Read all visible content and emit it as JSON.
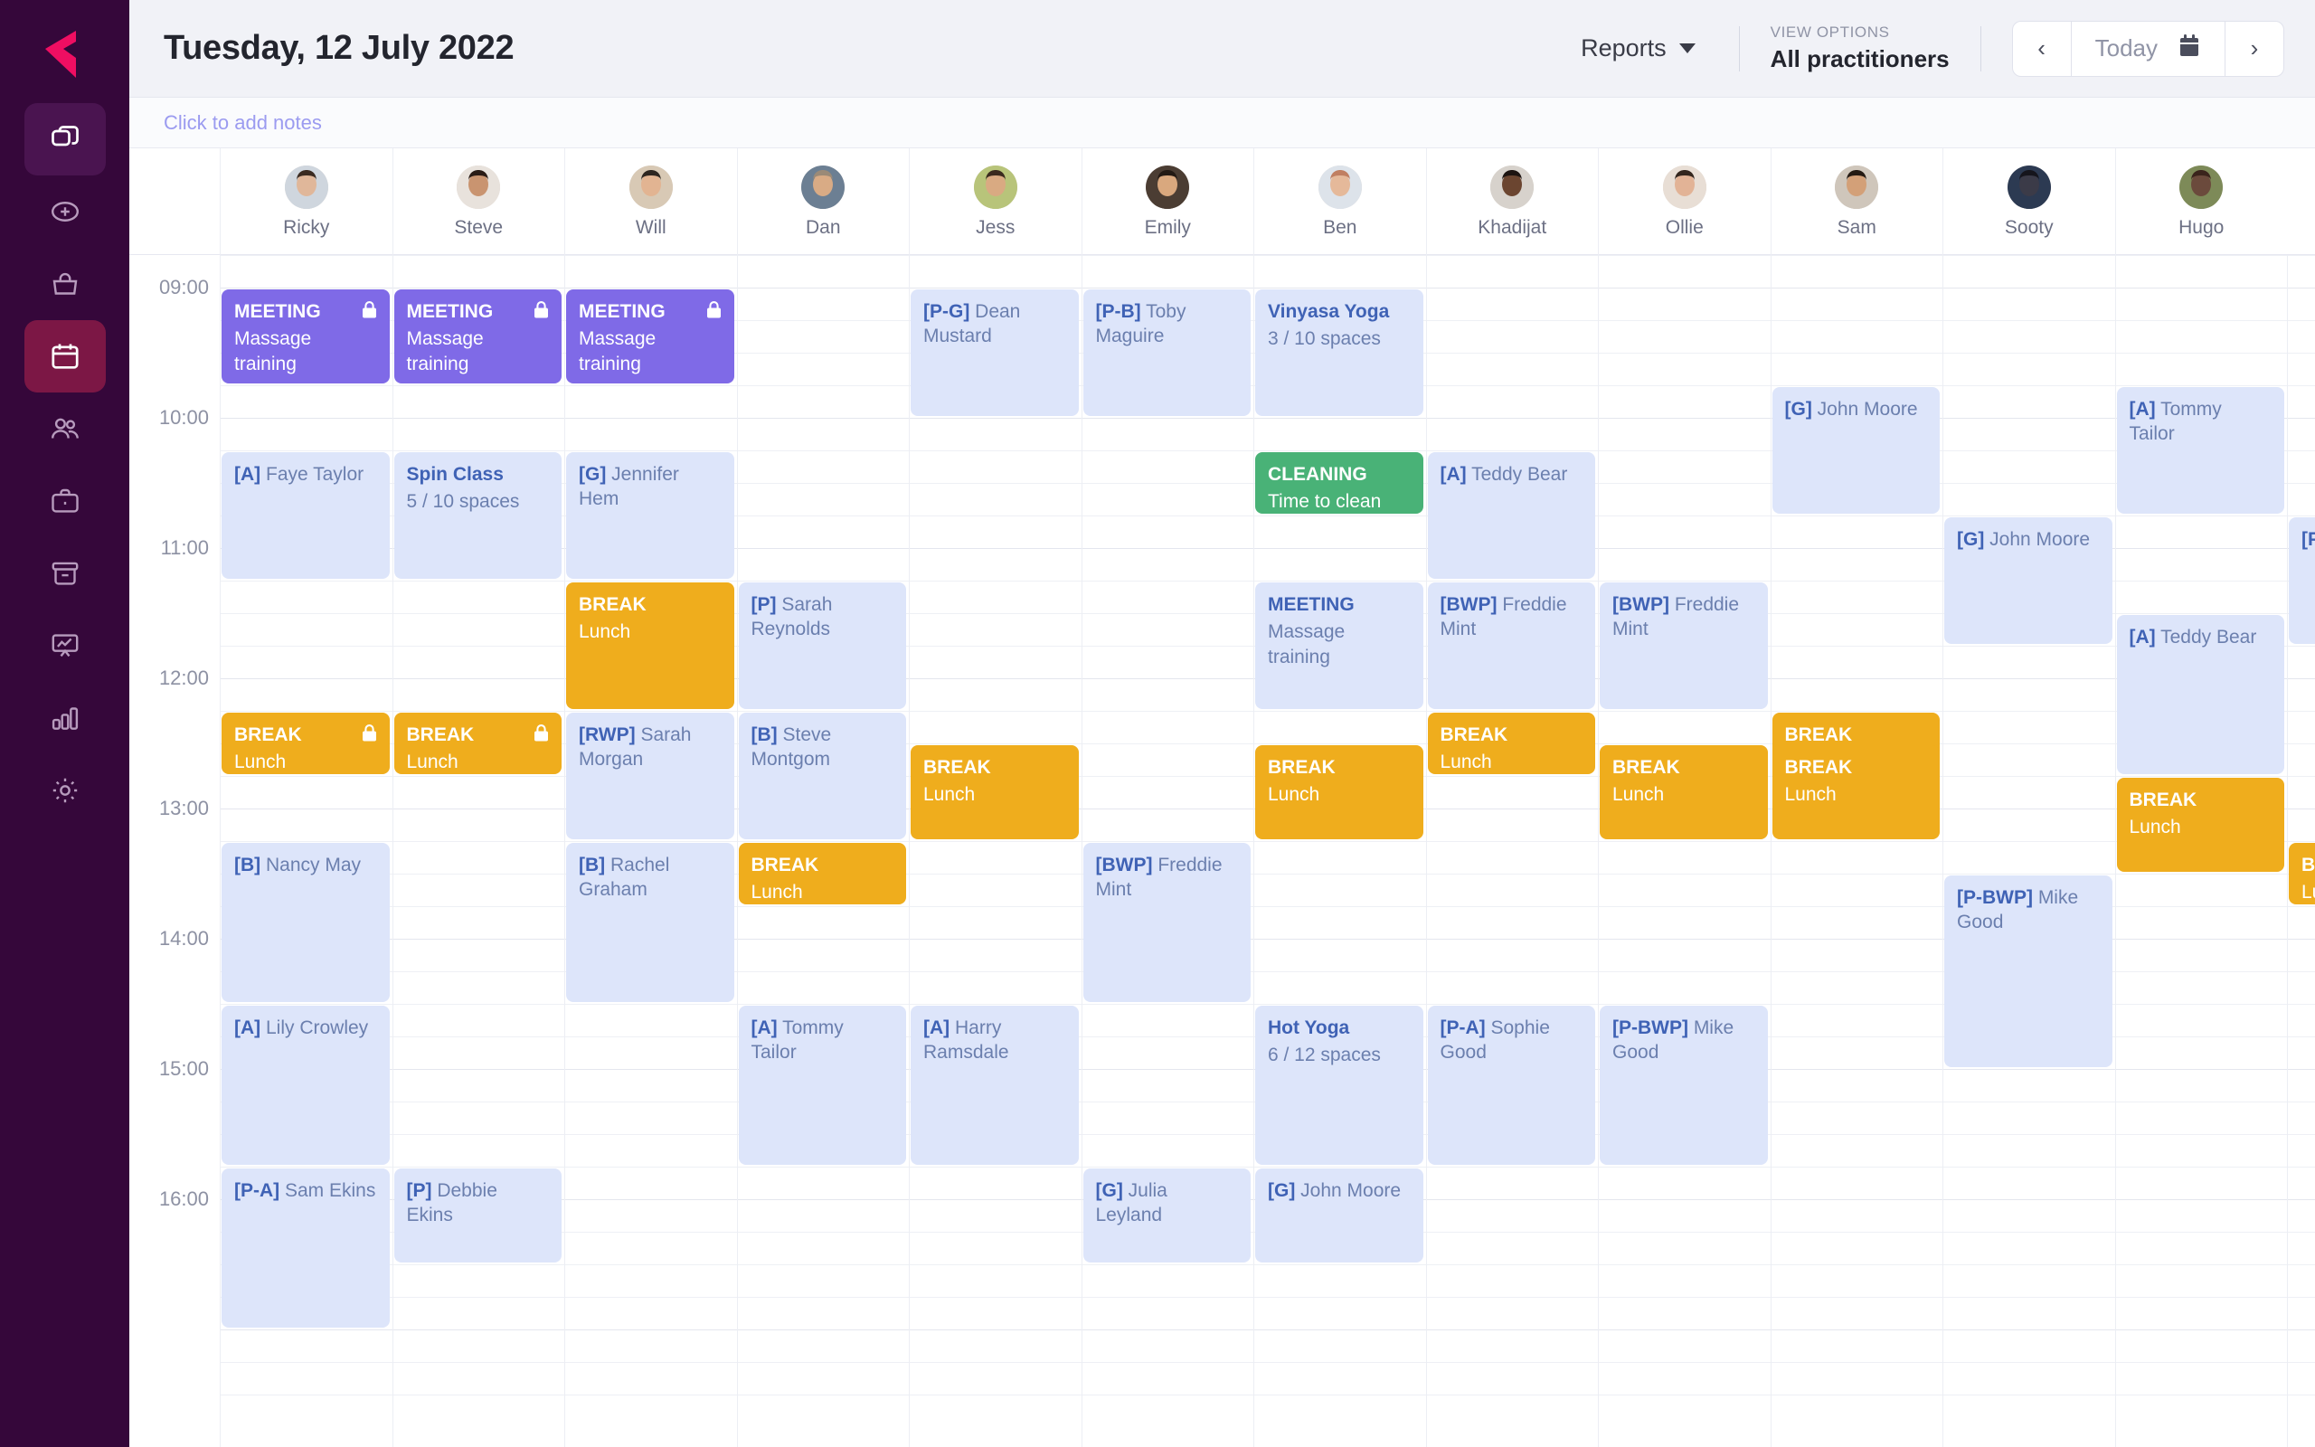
{
  "app": {
    "logo_name": "logo-mark",
    "accent_color": "#ef0e62",
    "nav_bg": "#35073a"
  },
  "nav": {
    "items": [
      {
        "icon": "copy-stack-icon",
        "name": "sidebar-item-dashboard",
        "state": "selected-dark"
      },
      {
        "icon": "plus-circle-icon",
        "name": "sidebar-item-add",
        "state": "normal"
      },
      {
        "icon": "bag-icon",
        "name": "sidebar-item-sales",
        "state": "normal"
      },
      {
        "icon": "calendar-icon",
        "name": "sidebar-item-calendar",
        "state": "selected-accent"
      },
      {
        "icon": "people-icon",
        "name": "sidebar-item-clients",
        "state": "normal"
      },
      {
        "icon": "briefcase-icon",
        "name": "sidebar-item-business",
        "state": "normal"
      },
      {
        "icon": "archive-icon",
        "name": "sidebar-item-stock",
        "state": "normal"
      },
      {
        "icon": "presentation-chart-icon",
        "name": "sidebar-item-marketing",
        "state": "normal"
      },
      {
        "icon": "bar-chart-icon",
        "name": "sidebar-item-reports",
        "state": "normal"
      },
      {
        "icon": "gear-icon",
        "name": "sidebar-item-settings",
        "state": "normal"
      }
    ]
  },
  "header": {
    "title": "Tuesday, 12 July 2022",
    "reports_label": "Reports",
    "view_options_label": "VIEW OPTIONS",
    "view_options_value": "All practitioners",
    "prev_label": "‹",
    "next_label": "›",
    "today_label": "Today"
  },
  "notes": {
    "placeholder": "Click to add notes"
  },
  "calendar": {
    "practitioners": [
      {
        "name": "Ricky",
        "skin": "#e0b79a",
        "hair": "#3a2b22",
        "shirt": "#cfd6de"
      },
      {
        "name": "Steve",
        "skin": "#c99470",
        "hair": "#2a1c16",
        "shirt": "#e8e2dc"
      },
      {
        "name": "Will",
        "skin": "#e2b492",
        "hair": "#2e2620",
        "shirt": "#d8c9b5"
      },
      {
        "name": "Dan",
        "skin": "#d9ab85",
        "hair": "#9b8a77",
        "shirt": "#6c7f93"
      },
      {
        "name": "Jess",
        "skin": "#d9aa82",
        "hair": "#3a2a1e",
        "shirt": "#b8c47a"
      },
      {
        "name": "Emily",
        "skin": "#d9a87e",
        "hair": "#231a14",
        "shirt": "#4b3d33"
      },
      {
        "name": "Ben",
        "skin": "#e5b99a",
        "hair": "#c07f62",
        "shirt": "#dde3ea"
      },
      {
        "name": "Khadijat",
        "skin": "#6b4530",
        "hair": "#1d1411",
        "shirt": "#d7d2cc"
      },
      {
        "name": "Ollie",
        "skin": "#e2b396",
        "hair": "#33261e",
        "shirt": "#e8ded5"
      },
      {
        "name": "Sam",
        "skin": "#d3a078",
        "hair": "#241a13",
        "shirt": "#cfc6bb"
      },
      {
        "name": "Sooty",
        "skin": "#3b3b48",
        "hair": "#15151c",
        "shirt": "#2c3a52"
      },
      {
        "name": "Hugo",
        "skin": "#6b4a3c",
        "hair": "#3a241c",
        "shirt": "#7d8a58"
      }
    ],
    "time_labels": [
      "09:00",
      "10:00",
      "11:00",
      "12:00",
      "13:00",
      "14:00",
      "15:00",
      "16:00"
    ],
    "slot_minutes": 15,
    "start_time": "08:45",
    "events": [
      {
        "col": 0,
        "start": "09:00",
        "end": "09:45",
        "type": "purple",
        "title": "MEETING",
        "subtitle": "Massage training",
        "locked": true
      },
      {
        "col": 1,
        "start": "09:00",
        "end": "09:45",
        "type": "purple",
        "title": "MEETING",
        "subtitle": "Massage training",
        "locked": true
      },
      {
        "col": 2,
        "start": "09:00",
        "end": "09:45",
        "type": "purple",
        "title": "MEETING",
        "subtitle": "Massage training",
        "locked": true
      },
      {
        "col": 4,
        "start": "09:00",
        "end": "10:00",
        "type": "blue",
        "code": "[P-G]",
        "client": "Dean Mustard"
      },
      {
        "col": 5,
        "start": "09:00",
        "end": "10:00",
        "type": "blue",
        "code": "[P-B]",
        "client": "Toby Maguire"
      },
      {
        "col": 6,
        "start": "09:00",
        "end": "10:00",
        "type": "blue",
        "title": "Vinyasa Yoga",
        "subtitle": "3 / 10 spaces"
      },
      {
        "col": 9,
        "start": "09:45",
        "end": "10:45",
        "type": "blue",
        "code": "[G]",
        "client": "John Moore"
      },
      {
        "col": 11,
        "start": "09:45",
        "end": "10:45",
        "type": "blue",
        "code": "[A]",
        "client": "Tommy Tailor"
      },
      {
        "col": 0,
        "start": "10:15",
        "end": "11:15",
        "type": "blue",
        "code": "[A]",
        "client": "Faye Taylor"
      },
      {
        "col": 1,
        "start": "10:15",
        "end": "11:15",
        "type": "blue",
        "title": "Spin Class",
        "subtitle": "5 / 10 spaces"
      },
      {
        "col": 2,
        "start": "10:15",
        "end": "11:15",
        "type": "blue",
        "code": "[G]",
        "client": "Jennifer Hem"
      },
      {
        "col": 6,
        "start": "10:15",
        "end": "10:45",
        "type": "green",
        "title": "CLEANING",
        "subtitle": "Time to clean"
      },
      {
        "col": 7,
        "start": "10:15",
        "end": "11:15",
        "type": "blue",
        "code": "[A]",
        "client": "Teddy Bear"
      },
      {
        "col": 10,
        "start": "10:45",
        "end": "11:45",
        "type": "blue",
        "code": "[G]",
        "client": "John Moore"
      },
      {
        "col": 2,
        "start": "11:15",
        "end": "12:15",
        "type": "orange",
        "title": "BREAK",
        "subtitle": "Lunch"
      },
      {
        "col": 3,
        "start": "11:15",
        "end": "12:15",
        "type": "blue",
        "code": "[P]",
        "client": "Sarah Reynolds"
      },
      {
        "col": 6,
        "start": "11:15",
        "end": "12:15",
        "type": "blue",
        "title": "MEETING",
        "subtitle": "Massage training"
      },
      {
        "col": 7,
        "start": "11:15",
        "end": "12:15",
        "type": "blue",
        "code": "[BWP]",
        "client": "Freddie Mint"
      },
      {
        "col": 8,
        "start": "11:15",
        "end": "12:15",
        "type": "blue",
        "code": "[BWP]",
        "client": "Freddie Mint"
      },
      {
        "col": 11,
        "start": "11:30",
        "end": "12:45",
        "type": "blue",
        "code": "[A]",
        "client": "Teddy Bear"
      },
      {
        "col": 0,
        "start": "12:15",
        "end": "12:45",
        "type": "orange",
        "title": "BREAK",
        "subtitle": "Lunch",
        "locked": true
      },
      {
        "col": 1,
        "start": "12:15",
        "end": "12:45",
        "type": "orange",
        "title": "BREAK",
        "subtitle": "Lunch",
        "locked": true
      },
      {
        "col": 2,
        "start": "12:15",
        "end": "13:15",
        "type": "blue",
        "code": "[RWP]",
        "client": "Sarah Morgan"
      },
      {
        "col": 3,
        "start": "12:15",
        "end": "13:15",
        "type": "blue",
        "code": "[B]",
        "client": "Steve Montgom"
      },
      {
        "col": 7,
        "start": "12:15",
        "end": "12:45",
        "type": "orange",
        "title": "BREAK",
        "subtitle": "Lunch"
      },
      {
        "col": 9,
        "start": "12:15",
        "end": "12:45",
        "type": "orange",
        "title": "BREAK",
        "subtitle": "Lunch"
      },
      {
        "col": 4,
        "start": "12:30",
        "end": "13:15",
        "type": "orange",
        "title": "BREAK",
        "subtitle": "Lunch"
      },
      {
        "col": 6,
        "start": "12:30",
        "end": "13:15",
        "type": "orange",
        "title": "BREAK",
        "subtitle": "Lunch"
      },
      {
        "col": 8,
        "start": "12:30",
        "end": "13:15",
        "type": "orange",
        "title": "BREAK",
        "subtitle": "Lunch"
      },
      {
        "col": 9,
        "start": "12:30",
        "end": "13:15",
        "type": "orange",
        "title": "BREAK",
        "subtitle": "Lunch"
      },
      {
        "col": 11,
        "start": "12:45",
        "end": "13:30",
        "type": "orange",
        "title": "BREAK",
        "subtitle": "Lunch"
      },
      {
        "col": 0,
        "start": "13:15",
        "end": "14:30",
        "type": "blue",
        "code": "[B]",
        "client": "Nancy May"
      },
      {
        "col": 2,
        "start": "13:15",
        "end": "14:30",
        "type": "blue",
        "code": "[B]",
        "client": "Rachel Graham"
      },
      {
        "col": 3,
        "start": "13:15",
        "end": "13:45",
        "type": "orange",
        "title": "BREAK",
        "subtitle": "Lunch"
      },
      {
        "col": 5,
        "start": "13:15",
        "end": "14:30",
        "type": "blue",
        "code": "[BWP]",
        "client": "Freddie Mint"
      },
      {
        "col": 10,
        "start": "13:30",
        "end": "15:00",
        "type": "blue",
        "code": "[P-BWP]",
        "client": "Mike Good"
      },
      {
        "col": 0,
        "start": "14:30",
        "end": "15:45",
        "type": "blue",
        "code": "[A]",
        "client": "Lily Crowley"
      },
      {
        "col": 3,
        "start": "14:30",
        "end": "15:45",
        "type": "blue",
        "code": "[A]",
        "client": "Tommy Tailor"
      },
      {
        "col": 4,
        "start": "14:30",
        "end": "15:45",
        "type": "blue",
        "code": "[A]",
        "client": "Harry Ramsdale"
      },
      {
        "col": 6,
        "start": "14:30",
        "end": "15:45",
        "type": "blue",
        "title": "Hot Yoga",
        "subtitle": "6 / 12 spaces"
      },
      {
        "col": 7,
        "start": "14:30",
        "end": "15:45",
        "type": "blue",
        "code": "[P-A]",
        "client": "Sophie Good"
      },
      {
        "col": 8,
        "start": "14:30",
        "end": "15:45",
        "type": "blue",
        "code": "[P-BWP]",
        "client": "Mike Good"
      },
      {
        "col": 0,
        "start": "15:45",
        "end": "17:00",
        "type": "blue",
        "code": "[P-A]",
        "client": "Sam Ekins"
      },
      {
        "col": 1,
        "start": "15:45",
        "end": "16:30",
        "type": "blue",
        "code": "[P]",
        "client": "Debbie Ekins"
      },
      {
        "col": 5,
        "start": "15:45",
        "end": "16:30",
        "type": "blue",
        "code": "[G]",
        "client": "Julia Leyland"
      },
      {
        "col": 6,
        "start": "15:45",
        "end": "16:30",
        "type": "blue",
        "code": "[G]",
        "client": "John Moore"
      },
      {
        "col": 12,
        "start": "10:45",
        "end": "11:45",
        "type": "blue",
        "code": "[P",
        "client": ""
      },
      {
        "col": 12,
        "start": "13:15",
        "end": "13:45",
        "type": "orange",
        "title": "BR",
        "subtitle": "Lu"
      }
    ]
  }
}
